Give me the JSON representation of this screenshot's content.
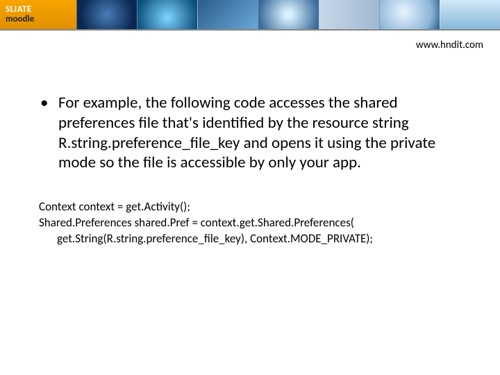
{
  "banner": {
    "logo_line1": "SLIATE",
    "logo_line2": "moodle"
  },
  "url": "www.hndit.com",
  "bullet": {
    "marker": "•",
    "text": "For example, the following code accesses the shared preferences file that's identified by the resource string R.string.preference_file_key and opens it using the private mode so the file is accessible by only your app."
  },
  "code": {
    "line1": "Context context = get.Activity();",
    "line2": "Shared.Preferences shared.Pref = context.get.Shared.Preferences(",
    "line3": "get.String(R.string.preference_file_key), Context.MODE_PRIVATE);"
  }
}
